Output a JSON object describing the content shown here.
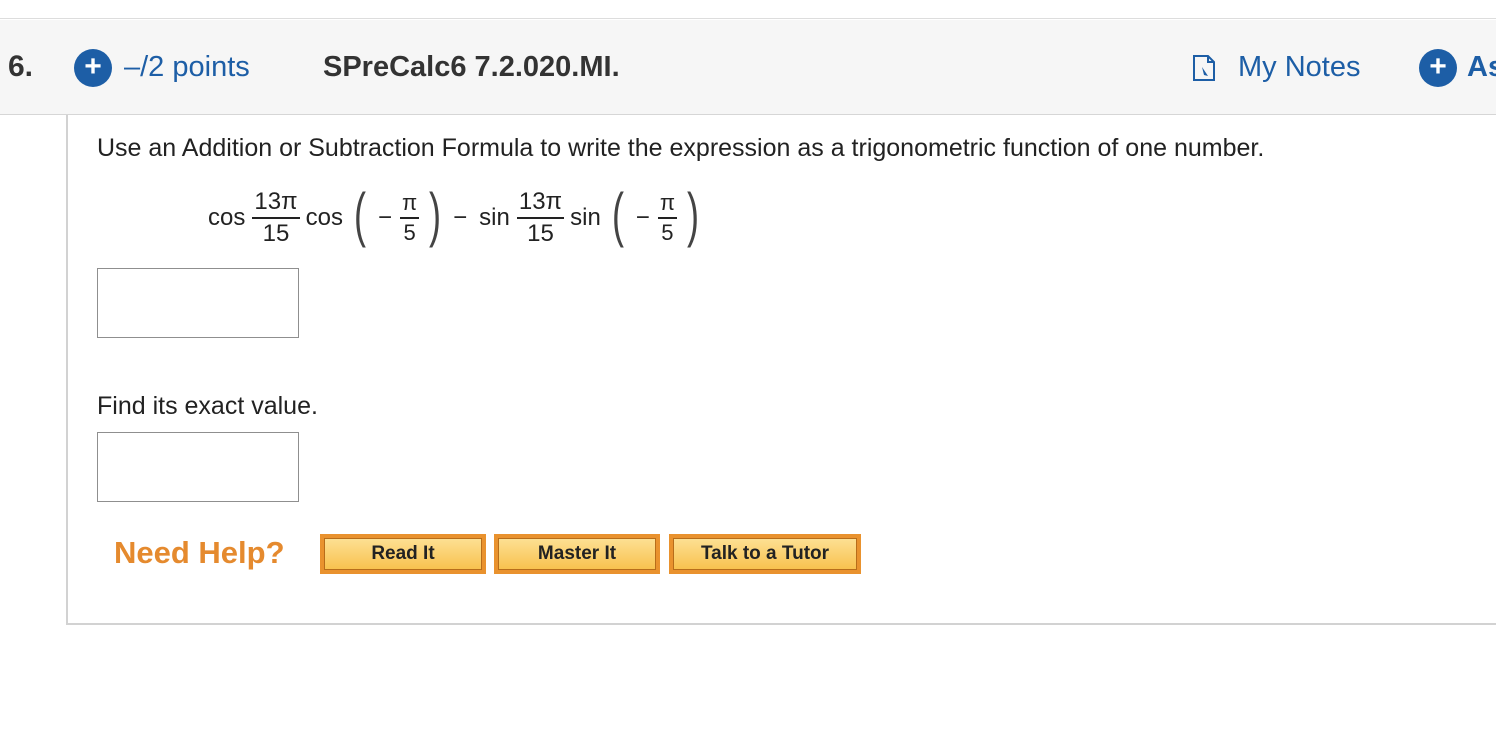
{
  "question": {
    "number": "6.",
    "points": "–/2 points",
    "source_id": "SPreCalc6 7.2.020.MI.",
    "my_notes_label": "My Notes",
    "add_label": "As"
  },
  "problem": {
    "instruction": "Use an Addition or Subtraction Formula to write the expression as a trigonometric function of one number.",
    "expression": {
      "term1_fn1": "cos",
      "term1_frac_num": "13π",
      "term1_frac_den": "15",
      "term1_fn2": "cos",
      "term1_arg_sign": "−",
      "term1_arg_num": "π",
      "term1_arg_den": "5",
      "operator": "−",
      "term2_fn1": "sin",
      "term2_frac_num": "13π",
      "term2_frac_den": "15",
      "term2_fn2": "sin",
      "term2_arg_sign": "−",
      "term2_arg_num": "π",
      "term2_arg_den": "5"
    },
    "answer1_value": "",
    "prompt2": "Find its exact value.",
    "answer2_value": ""
  },
  "help": {
    "label": "Need Help?",
    "buttons": [
      "Read It",
      "Master It",
      "Talk to a Tutor"
    ]
  },
  "colors": {
    "link_blue": "#1d5ea6",
    "help_orange": "#e58a2e",
    "button_gold": "#f8c24f"
  },
  "icons": {
    "points": "plus-circle-icon",
    "notes": "note-icon",
    "add": "plus-circle-icon"
  }
}
